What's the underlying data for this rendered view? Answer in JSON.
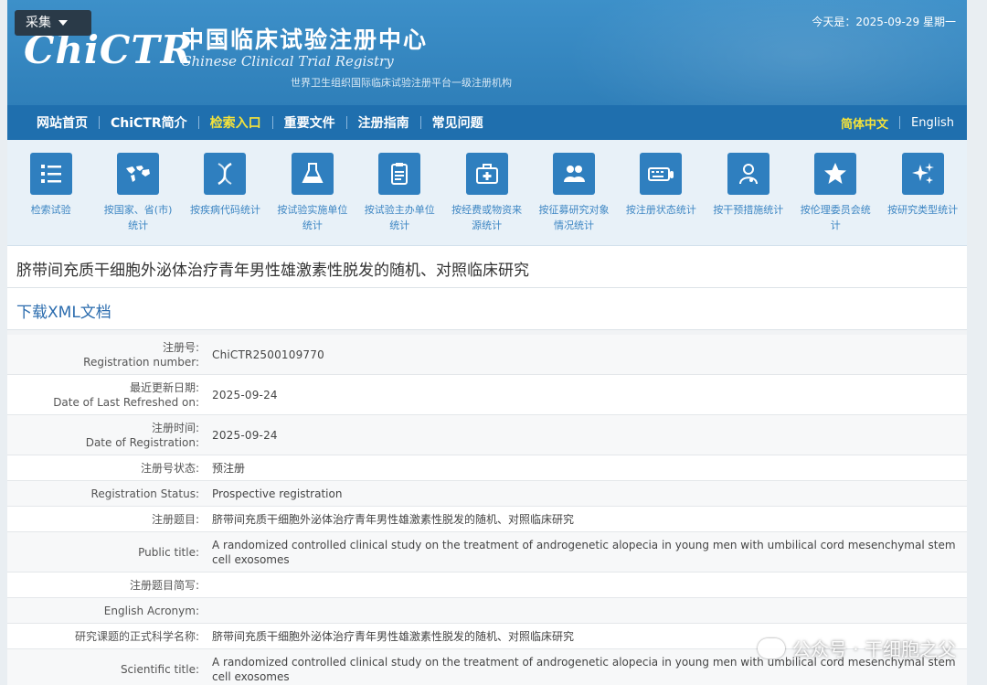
{
  "header": {
    "collect_label": "采集",
    "logo_text": "ChiCTR",
    "site_title_cn": "中国临床试验注册中心",
    "site_title_en": "Chinese Clinical Trial Registry",
    "site_subtitle": "世界卫生组织国际临床试验注册平台一级注册机构",
    "today_label": "今天是：",
    "today_date": "2025-09-29",
    "today_weekday": "星期一"
  },
  "nav": {
    "items": [
      "网站首页",
      "ChiCTR简介",
      "检索入口",
      "重要文件",
      "注册指南",
      "常见问题"
    ],
    "active_index": 2,
    "lang_cn": "简体中文",
    "lang_en": "English"
  },
  "icons": [
    {
      "icon": "list-icon",
      "label": "检索试验"
    },
    {
      "icon": "world-map-icon",
      "label": "按国家、省(市)统计"
    },
    {
      "icon": "dna-icon",
      "label": "按疾病代码统计"
    },
    {
      "icon": "flask-icon",
      "label": "按试验实施单位统计"
    },
    {
      "icon": "clipboard-icon",
      "label": "按试验主办单位统计"
    },
    {
      "icon": "medical-kit-icon",
      "label": "按经费或物资来源统计"
    },
    {
      "icon": "people-icon",
      "label": "按征募研究对象情况统计"
    },
    {
      "icon": "keyboard-icon",
      "label": "按注册状态统计"
    },
    {
      "icon": "doctor-icon",
      "label": "按干预措施统计"
    },
    {
      "icon": "star-icon",
      "label": "按伦理委员会统计"
    },
    {
      "icon": "sparkle-icon",
      "label": "按研究类型统计"
    }
  ],
  "page": {
    "title": "脐带间充质干细胞外泌体治疗青年男性雄激素性脱发的随机、对照临床研究",
    "xml_link": "下载XML文档"
  },
  "rows": [
    {
      "label_cn": "注册号:",
      "label_en": "Registration number:",
      "value": "ChiCTR2500109770"
    },
    {
      "label_cn": "最近更新日期:",
      "label_en": "Date of Last Refreshed on:",
      "value": "2025-09-24"
    },
    {
      "label_cn": "注册时间:",
      "label_en": "Date of Registration:",
      "value": "2025-09-24"
    },
    {
      "label_cn": "注册号状态:",
      "label_en": "",
      "value": "预注册"
    },
    {
      "label_cn": "",
      "label_en": "Registration Status:",
      "value": "Prospective registration"
    },
    {
      "label_cn": "注册题目:",
      "label_en": "",
      "value": "脐带间充质干细胞外泌体治疗青年男性雄激素性脱发的随机、对照临床研究"
    },
    {
      "label_cn": "",
      "label_en": "Public title:",
      "value": "A randomized controlled clinical study on the treatment of androgenetic alopecia in young men with umbilical cord mesenchymal stem cell exosomes"
    },
    {
      "label_cn": "注册题目简写:",
      "label_en": "",
      "value": ""
    },
    {
      "label_cn": "",
      "label_en": "English Acronym:",
      "value": ""
    },
    {
      "label_cn": "研究课题的正式科学名称:",
      "label_en": "",
      "value": "脐带间充质干细胞外泌体治疗青年男性雄激素性脱发的随机、对照临床研究"
    },
    {
      "label_cn": "",
      "label_en": "Scientific title:",
      "value": "A randomized controlled clinical study on the treatment of androgenetic alopecia in young men with umbilical cord mesenchymal stem cell exosomes"
    }
  ],
  "watermark": "公众号 · 干细胞之父",
  "colors": {
    "header_blue": "#3d90c9",
    "nav_blue": "#1f6fae",
    "active_yellow": "#f5e33a",
    "icon_blue": "#2f7fbf",
    "link_blue": "#2b6cae"
  }
}
